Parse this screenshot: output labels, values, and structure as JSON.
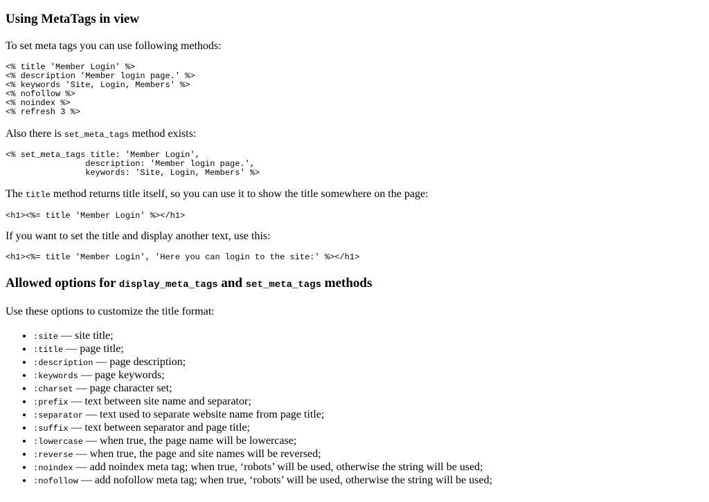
{
  "section1": {
    "heading": "Using MetaTags in view",
    "intro": "To set meta tags you can use following methods:",
    "code_methods": "<% title 'Member Login' %>\n<% description 'Member login page.' %>\n<% keywords 'Site, Login, Members' %>\n<% nofollow %>\n<% noindex %>\n<% refresh 3 %>",
    "also_before": "Also there is ",
    "also_code": "set_meta_tags",
    "also_after": " method exists:",
    "code_set_meta_tags": "<% set_meta_tags title: 'Member Login',\n                description: 'Member login page.',\n                keywords: 'Site, Login, Members' %>",
    "title_before": "The ",
    "title_code": "title",
    "title_after": " method returns title itself, so you can use it to show the title somewhere on the page:",
    "code_h1_title": "<h1><%= title 'Member Login' %></h1>",
    "another_text": "If you want to set the title and display another text, use this:",
    "code_h1_title_text": "<h1><%= title 'Member Login', 'Here you can login to the site:' %></h1>"
  },
  "section2": {
    "heading_before": "Allowed options for ",
    "heading_code1": "display_meta_tags",
    "heading_mid": " and ",
    "heading_code2": "set_meta_tags",
    "heading_after": " methods",
    "intro": "Use these options to customize the title format:",
    "options": [
      {
        "name": ":site",
        "desc": " — site title;"
      },
      {
        "name": ":title",
        "desc": " — page title;"
      },
      {
        "name": ":description",
        "desc": " — page description;"
      },
      {
        "name": ":keywords",
        "desc": " — page keywords;"
      },
      {
        "name": ":charset",
        "desc": " — page character set;"
      },
      {
        "name": ":prefix",
        "desc": " — text between site name and separator;"
      },
      {
        "name": ":separator",
        "desc": " — text used to separate website name from page title;"
      },
      {
        "name": ":suffix",
        "desc": " — text between separator and page title;"
      },
      {
        "name": ":lowercase",
        "desc": " — when true, the page name will be lowercase;"
      },
      {
        "name": ":reverse",
        "desc": " — when true, the page and site names will be reversed;"
      },
      {
        "name": ":noindex",
        "desc": " — add noindex meta tag; when true, ‘robots’ will be used, otherwise the string will be used;"
      },
      {
        "name": ":nofollow",
        "desc": " — add nofollow meta tag; when true, ‘robots’ will be used, otherwise the string will be used;"
      }
    ]
  }
}
